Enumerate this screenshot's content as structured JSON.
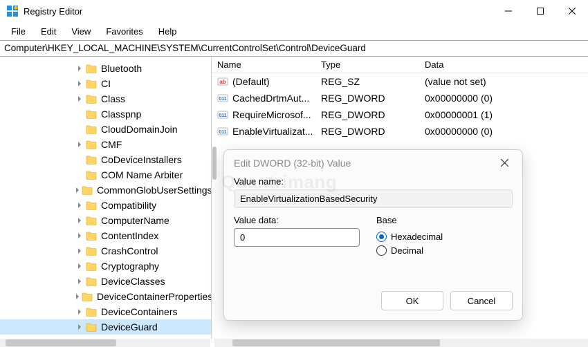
{
  "title": "Registry Editor",
  "menus": {
    "file": "File",
    "edit": "Edit",
    "view": "View",
    "favorites": "Favorites",
    "help": "Help"
  },
  "address": "Computer\\HKEY_LOCAL_MACHINE\\SYSTEM\\CurrentControlSet\\Control\\DeviceGuard",
  "tree": [
    {
      "label": "Bluetooth",
      "exp": ">"
    },
    {
      "label": "CI",
      "exp": ">"
    },
    {
      "label": "Class",
      "exp": ">"
    },
    {
      "label": "Classpnp",
      "exp": ""
    },
    {
      "label": "CloudDomainJoin",
      "exp": ""
    },
    {
      "label": "CMF",
      "exp": ">"
    },
    {
      "label": "CoDeviceInstallers",
      "exp": ""
    },
    {
      "label": "COM Name Arbiter",
      "exp": ""
    },
    {
      "label": "CommonGlobUserSettings",
      "exp": ">"
    },
    {
      "label": "Compatibility",
      "exp": ">"
    },
    {
      "label": "ComputerName",
      "exp": ">"
    },
    {
      "label": "ContentIndex",
      "exp": ">"
    },
    {
      "label": "CrashControl",
      "exp": ">"
    },
    {
      "label": "Cryptography",
      "exp": ">"
    },
    {
      "label": "DeviceClasses",
      "exp": ">"
    },
    {
      "label": "DeviceContainerProperties",
      "exp": ">"
    },
    {
      "label": "DeviceContainers",
      "exp": ">"
    },
    {
      "label": "DeviceGuard",
      "exp": ">",
      "sel": true
    }
  ],
  "columns": {
    "name": "Name",
    "type": "Type",
    "data": "Data"
  },
  "rows": [
    {
      "icon": "sz",
      "name": "(Default)",
      "type": "REG_SZ",
      "data": "(value not set)"
    },
    {
      "icon": "dw",
      "name": "CachedDrtmAut...",
      "type": "REG_DWORD",
      "data": "0x00000000 (0)"
    },
    {
      "icon": "dw",
      "name": "RequireMicrosof...",
      "type": "REG_DWORD",
      "data": "0x00000001 (1)"
    },
    {
      "icon": "dw",
      "name": "EnableVirtualizat...",
      "type": "REG_DWORD",
      "data": "0x00000000 (0)"
    }
  ],
  "dialog": {
    "title": "Edit DWORD (32-bit) Value",
    "value_name_label": "Value name:",
    "value_name": "EnableVirtualizationBasedSecurity",
    "value_data_label": "Value data:",
    "value_data": "0",
    "base_label": "Base",
    "hex": "Hexadecimal",
    "dec": "Decimal",
    "ok": "OK",
    "cancel": "Cancel"
  },
  "watermark": "Quantrimang"
}
